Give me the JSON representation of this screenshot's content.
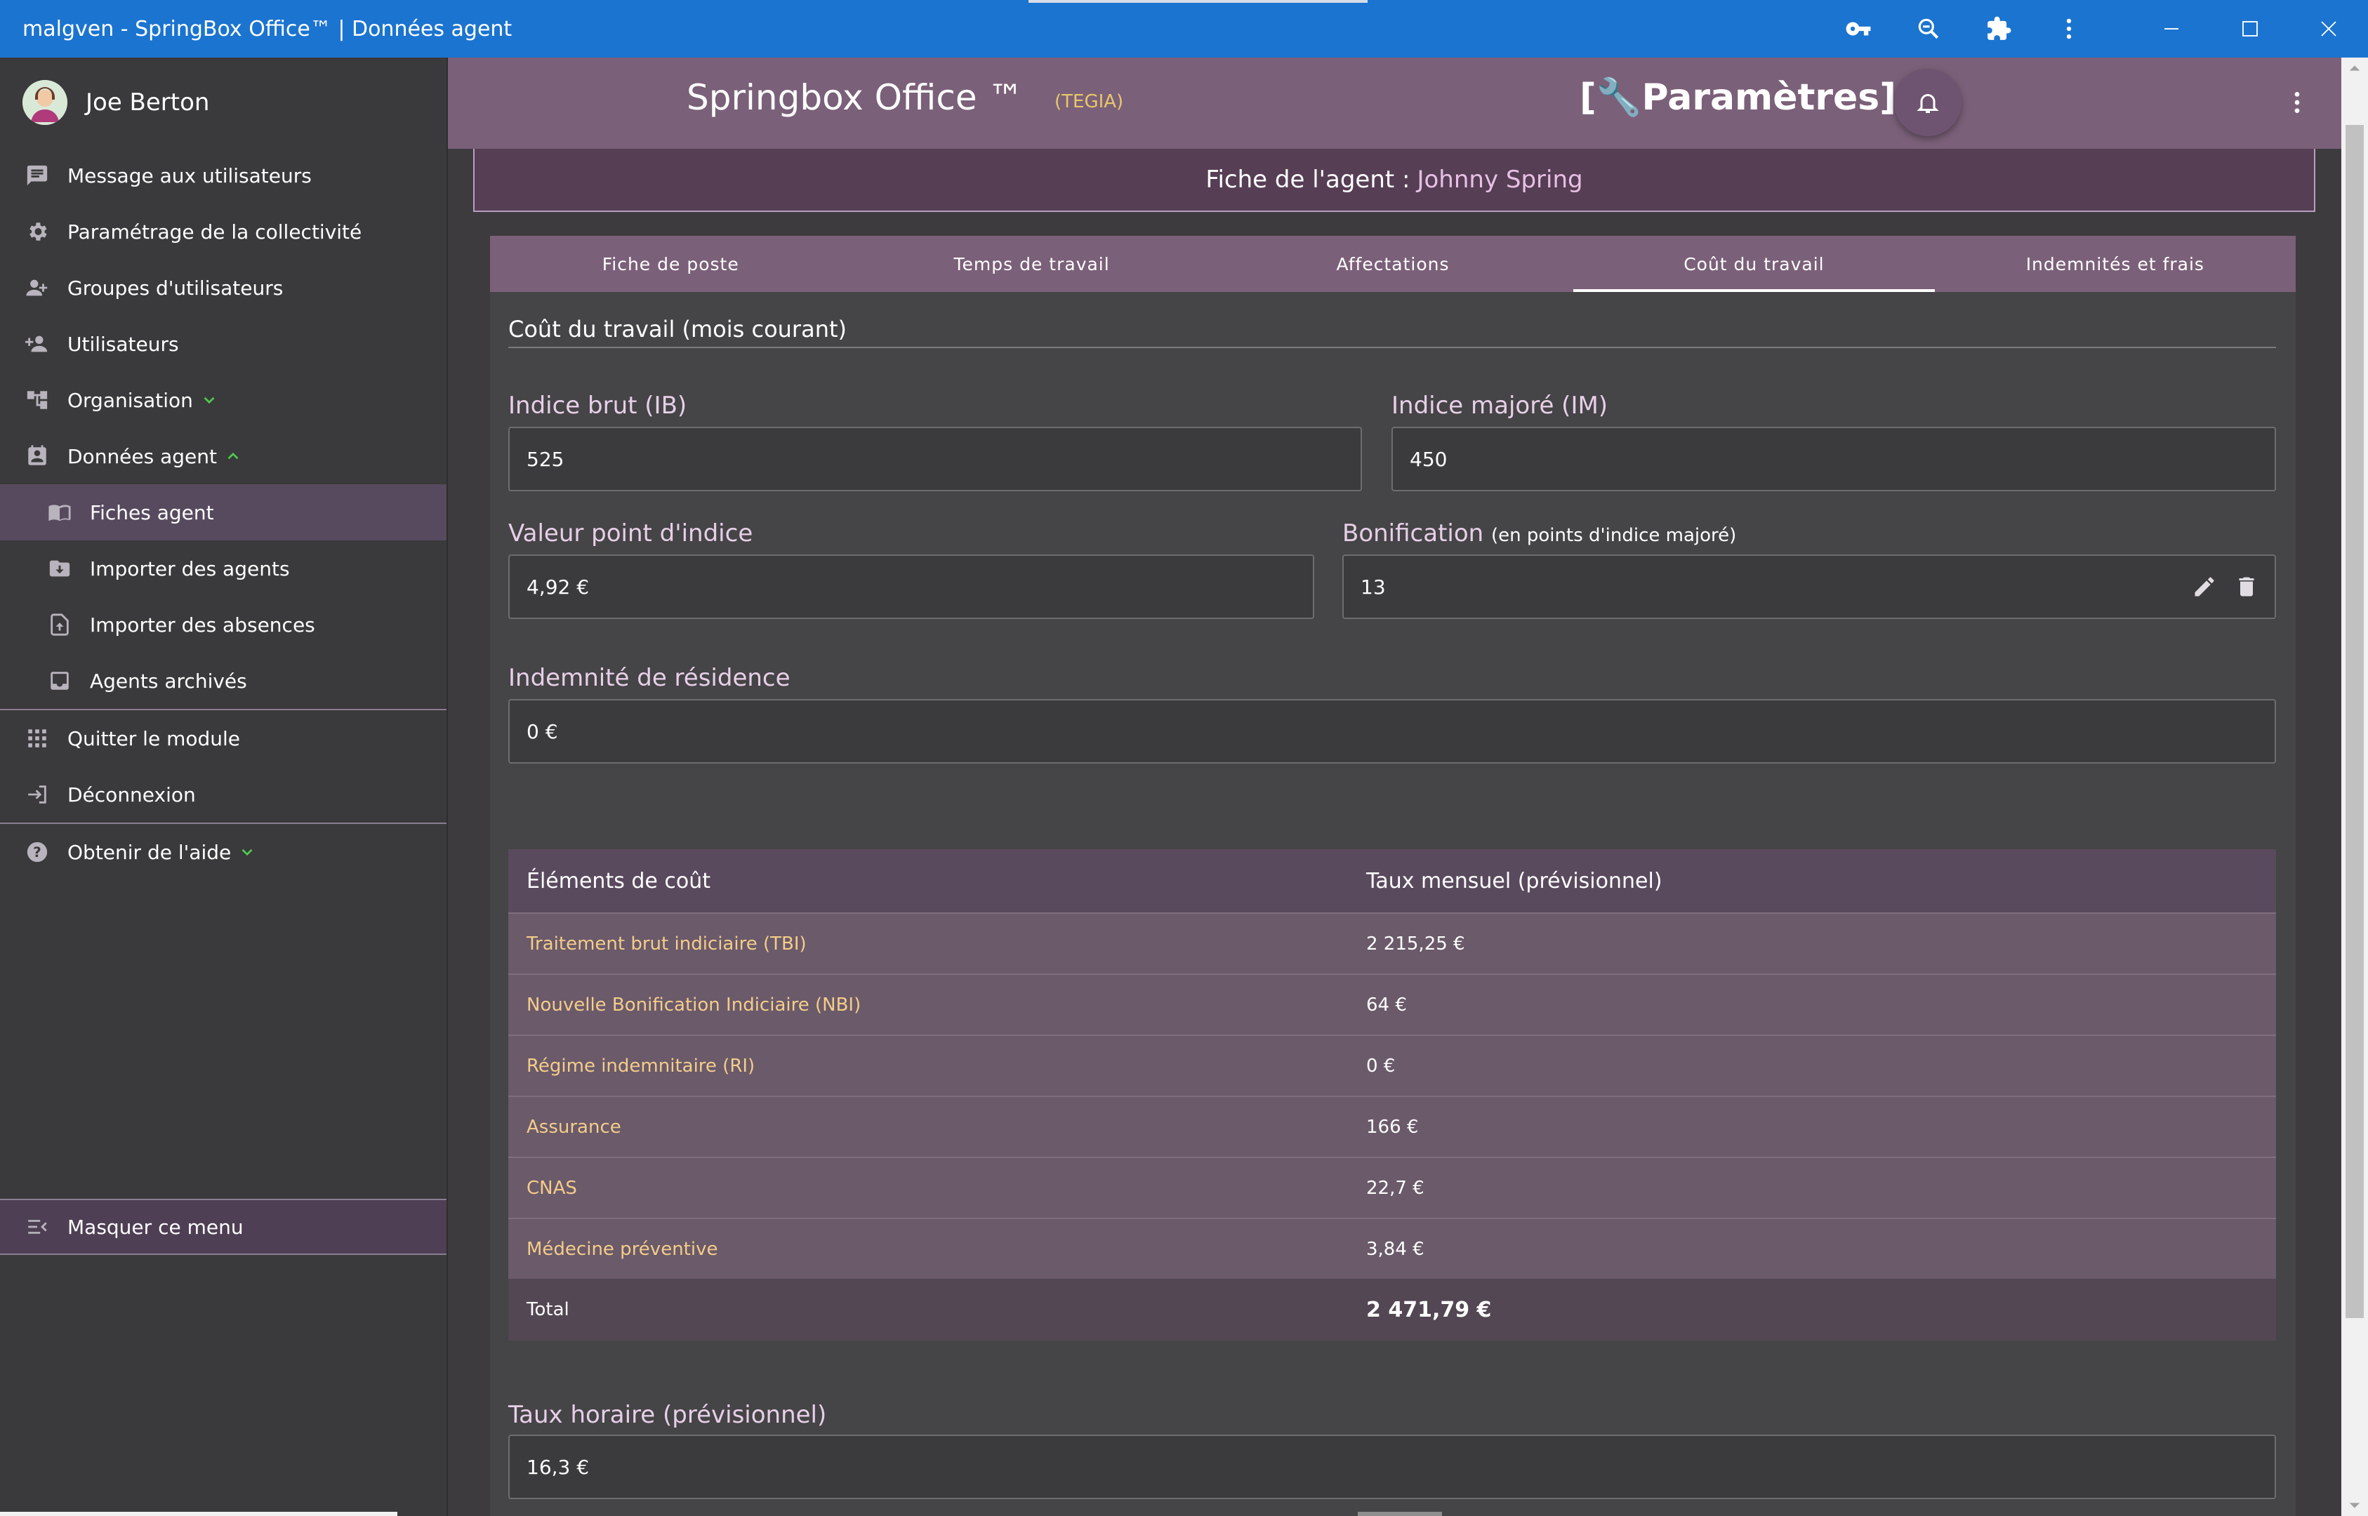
{
  "window": {
    "title": "malgven - SpringBox Office™ | Données agent"
  },
  "titlebar_icons": [
    "key-icon",
    "zoom-out-icon",
    "puzzle-icon",
    "kebab-icon"
  ],
  "user": {
    "name": "Joe Berton"
  },
  "sidebar": {
    "items": [
      {
        "label": "Message aux utilisateurs",
        "icon": "message-icon"
      },
      {
        "label": "Paramétrage de la collectivité",
        "icon": "gear-icon"
      },
      {
        "label": "Groupes d'utilisateurs",
        "icon": "group-icon"
      },
      {
        "label": "Utilisateurs",
        "icon": "person-add-icon"
      },
      {
        "label": "Organisation",
        "icon": "org-icon",
        "expanded": false
      },
      {
        "label": "Données agent",
        "icon": "agent-card-icon",
        "expanded": true
      },
      {
        "label": "Fiches agent",
        "icon": "book-icon",
        "active": true
      },
      {
        "label": "Importer des agents",
        "icon": "import-icon"
      },
      {
        "label": "Importer des absences",
        "icon": "upload-file-icon"
      },
      {
        "label": "Agents archivés",
        "icon": "archive-icon"
      },
      {
        "label": "Quitter le module",
        "icon": "apps-icon"
      },
      {
        "label": "Déconnexion",
        "icon": "logout-icon"
      },
      {
        "label": "Obtenir de l'aide",
        "icon": "help-icon",
        "expanded": false
      }
    ],
    "hide_menu": "Masquer ce menu"
  },
  "header": {
    "app_title": "Springbox Office ™",
    "org": "(TEGIA)",
    "params": "[🔧Paramètres]"
  },
  "agent": {
    "prefix": "Fiche de l'agent :",
    "name": "Johnny Spring"
  },
  "tabs": [
    {
      "label": "Fiche de poste"
    },
    {
      "label": "Temps de travail"
    },
    {
      "label": "Affectations"
    },
    {
      "label": "Coût du travail",
      "active": true
    },
    {
      "label": "Indemnités et frais"
    }
  ],
  "form": {
    "section_title": "Coût du travail (mois courant)",
    "indice_brut_label": "Indice brut (IB)",
    "indice_brut_value": "525",
    "indice_majore_label": "Indice majoré (IM)",
    "indice_majore_value": "450",
    "valeur_point_label": "Valeur point d'indice",
    "valeur_point_value": "4,92 €",
    "bonification_label": "Bonification",
    "bonification_sub": "(en points d'indice majoré)",
    "bonification_value": "13",
    "residence_label": "Indemnité de résidence",
    "residence_value": "0 €",
    "taux_horaire_label": "Taux horaire (prévisionnel)",
    "taux_horaire_value": "16,3 €"
  },
  "cost_table": {
    "headers": [
      "Éléments de coût",
      "Taux mensuel (prévisionnel)"
    ],
    "rows": [
      {
        "label": "Traitement brut indiciaire (TBI)",
        "value": "2 215,25 €"
      },
      {
        "label": "Nouvelle Bonification Indiciaire (NBI)",
        "value": "64 €"
      },
      {
        "label": "Régime indemnitaire (RI)",
        "value": "0 €"
      },
      {
        "label": "Assurance",
        "value": "166 €"
      },
      {
        "label": "CNAS",
        "value": "22,7 €"
      },
      {
        "label": "Médecine préventive",
        "value": "3,84 €"
      }
    ],
    "total_label": "Total",
    "total_value": "2 471,79 €"
  },
  "colors": {
    "titlebar": "#1b74d0",
    "header": "#7b6079",
    "sidebar_active": "#574a5f",
    "cost_label": "#f4cc8a"
  }
}
